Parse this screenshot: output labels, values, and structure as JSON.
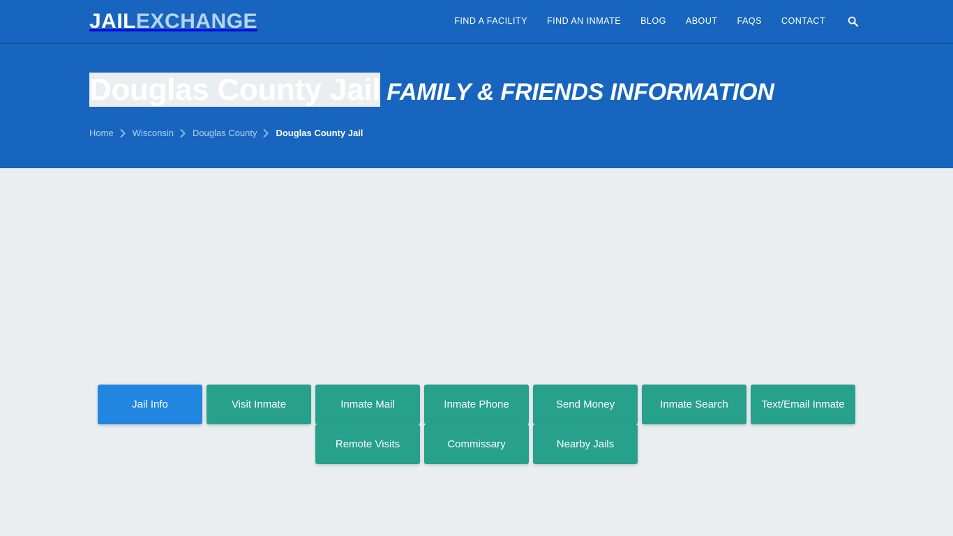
{
  "brand": {
    "part1": "JAIL",
    "part2": "EXCHANGE"
  },
  "nav": {
    "items": [
      {
        "label": "FIND A FACILITY",
        "name": "nav-find-a-facility"
      },
      {
        "label": "FIND AN INMATE",
        "name": "nav-find-an-inmate"
      },
      {
        "label": "BLOG",
        "name": "nav-blog"
      },
      {
        "label": "ABOUT",
        "name": "nav-about"
      },
      {
        "label": "FAQs",
        "name": "nav-faqs"
      },
      {
        "label": "CONTACT",
        "name": "nav-contact"
      }
    ],
    "search_icon": "search-icon"
  },
  "hero": {
    "title_main": "Douglas County Jail",
    "title_sub": "FAMILY & FRIENDS INFORMATION",
    "breadcrumb": [
      {
        "label": "Home",
        "current": false
      },
      {
        "label": "Wisconsin",
        "current": false
      },
      {
        "label": "Douglas County",
        "current": false
      },
      {
        "label": "Douglas County Jail",
        "current": true
      }
    ],
    "separator_icon": "chevron-right-icon"
  },
  "tabs": {
    "row1": [
      {
        "label": "Jail Info",
        "active": true
      },
      {
        "label": "Visit Inmate",
        "active": false
      },
      {
        "label": "Inmate Mail",
        "active": false
      },
      {
        "label": "Inmate Phone",
        "active": false
      },
      {
        "label": "Send Money",
        "active": false
      },
      {
        "label": "Inmate Search",
        "active": false
      },
      {
        "label": "Text/Email Inmate",
        "active": false
      }
    ],
    "row2": [
      {
        "label": "Remote Visits",
        "active": false
      },
      {
        "label": "Commissary",
        "active": false
      },
      {
        "label": "Nearby Jails",
        "active": false
      }
    ]
  },
  "colors": {
    "header_blue": "#1765bf",
    "active_tab_blue": "#2186e0",
    "tab_teal": "#27a08c",
    "page_background": "#eaeef1",
    "brand_accent": "#b6d3ef"
  }
}
